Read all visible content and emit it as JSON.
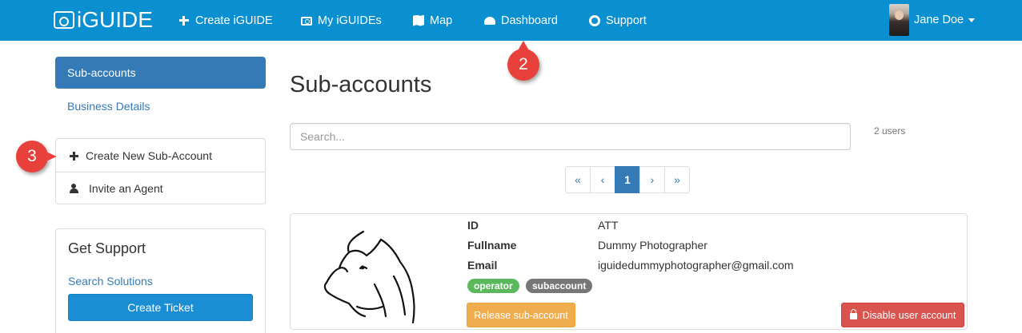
{
  "navbar": {
    "brand": "iGUIDE",
    "items": [
      {
        "label": "Create iGUIDE",
        "icon": "plus-icon"
      },
      {
        "label": "My iGUIDEs",
        "icon": "camera-icon"
      },
      {
        "label": "Map",
        "icon": "map-icon"
      },
      {
        "label": "Dashboard",
        "icon": "dashboard-icon"
      },
      {
        "label": "Support",
        "icon": "life-ring-icon"
      }
    ],
    "user_name": "Jane Doe"
  },
  "sidebar": {
    "active_item": "Sub-accounts",
    "link": "Business Details",
    "actions": [
      {
        "label": "Create New Sub-Account",
        "icon": "plus-icon"
      },
      {
        "label": "Invite an Agent",
        "icon": "user-plus-icon"
      }
    ],
    "support": {
      "title": "Get Support",
      "link": "Search Solutions",
      "button": "Create Ticket"
    }
  },
  "main": {
    "title": "Sub-accounts",
    "search_placeholder": "Search...",
    "user_count": "2 users",
    "pagination": [
      "«",
      "‹",
      "1",
      "›",
      "»"
    ],
    "current_page": "1"
  },
  "user_card": {
    "fields": [
      {
        "label": "ID",
        "value": "ATT"
      },
      {
        "label": "Fullname",
        "value": "Dummy Photographer"
      },
      {
        "label": "Email",
        "value": "iguidedummyphotographer@gmail.com"
      }
    ],
    "badges": [
      "operator",
      "subaccount"
    ],
    "release_button": "Release sub-account",
    "disable_button": "Disable user account"
  },
  "annotations": {
    "marker_dashboard": "2",
    "marker_create": "3"
  },
  "colors": {
    "navbar": "#0a8fd1",
    "primary": "#337ab7",
    "success": "#5cb85c",
    "warning": "#f0ad4e",
    "danger": "#d9534f",
    "marker": "#e8413c"
  }
}
